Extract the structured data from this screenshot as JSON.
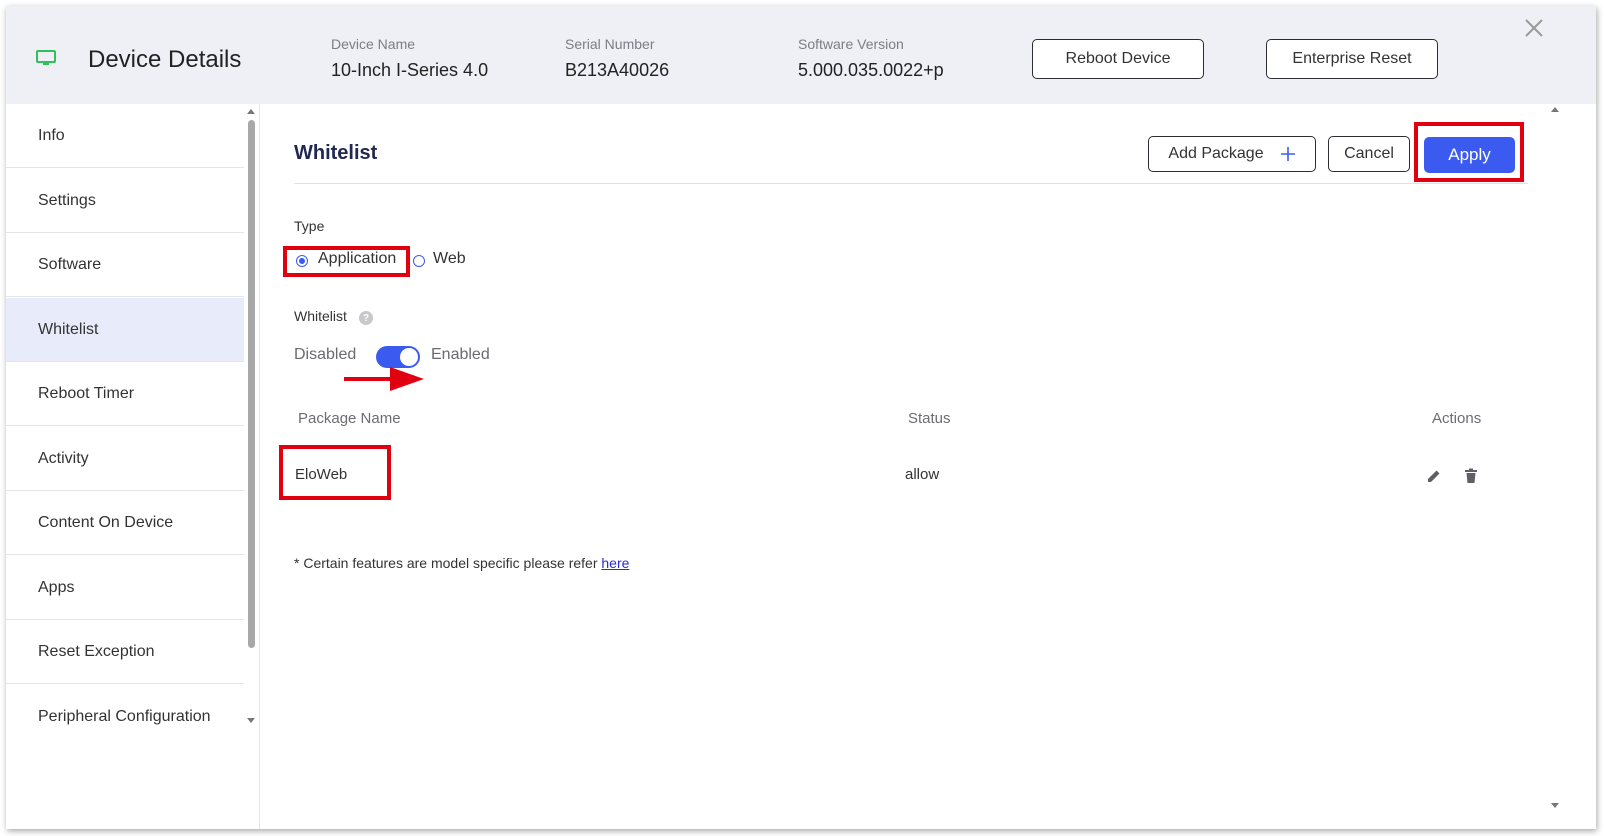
{
  "header": {
    "title": "Device Details",
    "device_name_label": "Device Name",
    "device_name_value": "10-Inch I-Series 4.0",
    "serial_label": "Serial Number",
    "serial_value": "B213A40026",
    "software_label": "Software Version",
    "software_value": "5.000.035.0022+p",
    "reboot_button": "Reboot Device",
    "enterprise_reset_button": "Enterprise Reset"
  },
  "sidebar": {
    "items": [
      {
        "label": "Info"
      },
      {
        "label": "Settings"
      },
      {
        "label": "Software"
      },
      {
        "label": "Whitelist"
      },
      {
        "label": "Reboot Timer"
      },
      {
        "label": "Activity"
      },
      {
        "label": "Content On Device"
      },
      {
        "label": "Apps"
      },
      {
        "label": "Reset Exception"
      },
      {
        "label": "Peripheral Configuration"
      }
    ],
    "active": "Whitelist"
  },
  "main": {
    "title": "Whitelist",
    "add_package_label": "Add Package",
    "cancel_label": "Cancel",
    "apply_label": "Apply",
    "type_label": "Type",
    "type_options": [
      "Application",
      "Web"
    ],
    "type_selected": "Application",
    "whitelist_label": "Whitelist",
    "help_glyph": "?",
    "toggle_off_label": "Disabled",
    "toggle_on_label": "Enabled",
    "toggle_state": "Enabled",
    "table": {
      "columns": [
        "Package Name",
        "Status",
        "Actions"
      ],
      "rows": [
        {
          "package": "EloWeb",
          "status": "allow"
        }
      ]
    },
    "note_text": "* Certain features are model specific please refer ",
    "note_link": "here"
  },
  "colors": {
    "accent": "#3b5bf0",
    "highlight_box": "#e0000f",
    "monitor_icon": "#2fc25b",
    "header_bg": "#eef0f5",
    "sidebar_active_bg": "#e7ebfa"
  },
  "icons": {
    "monitor": "monitor-icon",
    "close": "close-icon",
    "plus": "plus-icon",
    "help": "help-icon",
    "edit": "pencil-icon",
    "delete": "trash-icon",
    "arrow": "red-arrow-annotation"
  }
}
